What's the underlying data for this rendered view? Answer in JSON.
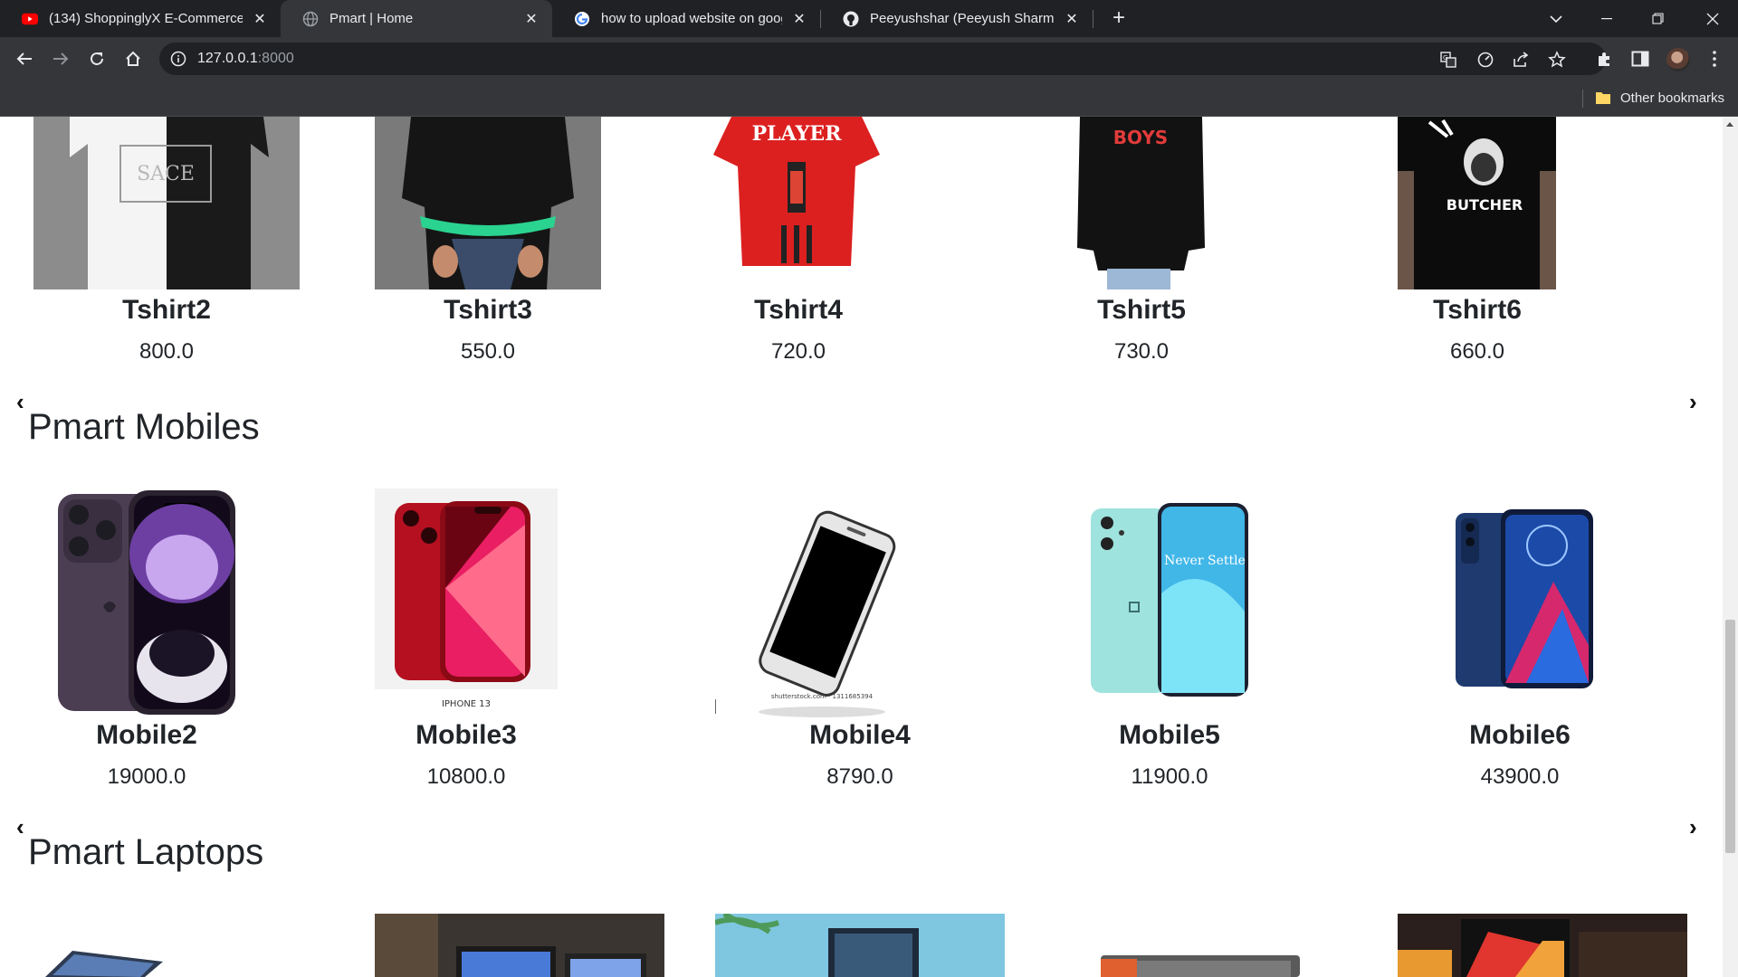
{
  "browser": {
    "tabs": [
      {
        "title": "(134) ShoppinglyX E-Commerce",
        "icon": "youtube-icon"
      },
      {
        "title": "Pmart | Home",
        "icon": "globe-icon"
      },
      {
        "title": "how to upload website on googl",
        "icon": "google-icon"
      },
      {
        "title": "Peeyushshar (Peeyush Sharma) ·",
        "icon": "github-icon"
      }
    ],
    "url_host": "127.0.0.1",
    "url_port": ":8000",
    "bookmarks_label": "Other bookmarks"
  },
  "tshirts": [
    {
      "name": "Tshirt2",
      "price": "800.0"
    },
    {
      "name": "Tshirt3",
      "price": "550.0"
    },
    {
      "name": "Tshirt4",
      "price": "720.0"
    },
    {
      "name": "Tshirt5",
      "price": "730.0"
    },
    {
      "name": "Tshirt6",
      "price": "660.0"
    }
  ],
  "image_text": {
    "tshirt2_logo": "SACE",
    "tshirt4_logo": "PLAYER",
    "tshirt5_logo": "BOYS",
    "tshirt6_logo": "BUTCHER",
    "mobile3_caption": "IPHONE 13",
    "mobile4_caption": "shutterstock.com · 1311685394",
    "mobile5_screen": "Never Settle"
  },
  "mobiles_section": {
    "title": "Pmart Mobiles",
    "prev": "‹",
    "next": "›",
    "items": [
      {
        "name": "Mobile2",
        "price": "19000.0"
      },
      {
        "name": "Mobile3",
        "price": "10800.0"
      },
      {
        "name": "Mobile4",
        "price": "8790.0"
      },
      {
        "name": "Mobile5",
        "price": "11900.0"
      },
      {
        "name": "Mobile6",
        "price": "43900.0"
      }
    ]
  },
  "laptops_section": {
    "title": "Pmart Laptops",
    "prev": "‹",
    "next": "›"
  },
  "tshirt_carousel": {
    "prev": "‹",
    "next": "›"
  }
}
